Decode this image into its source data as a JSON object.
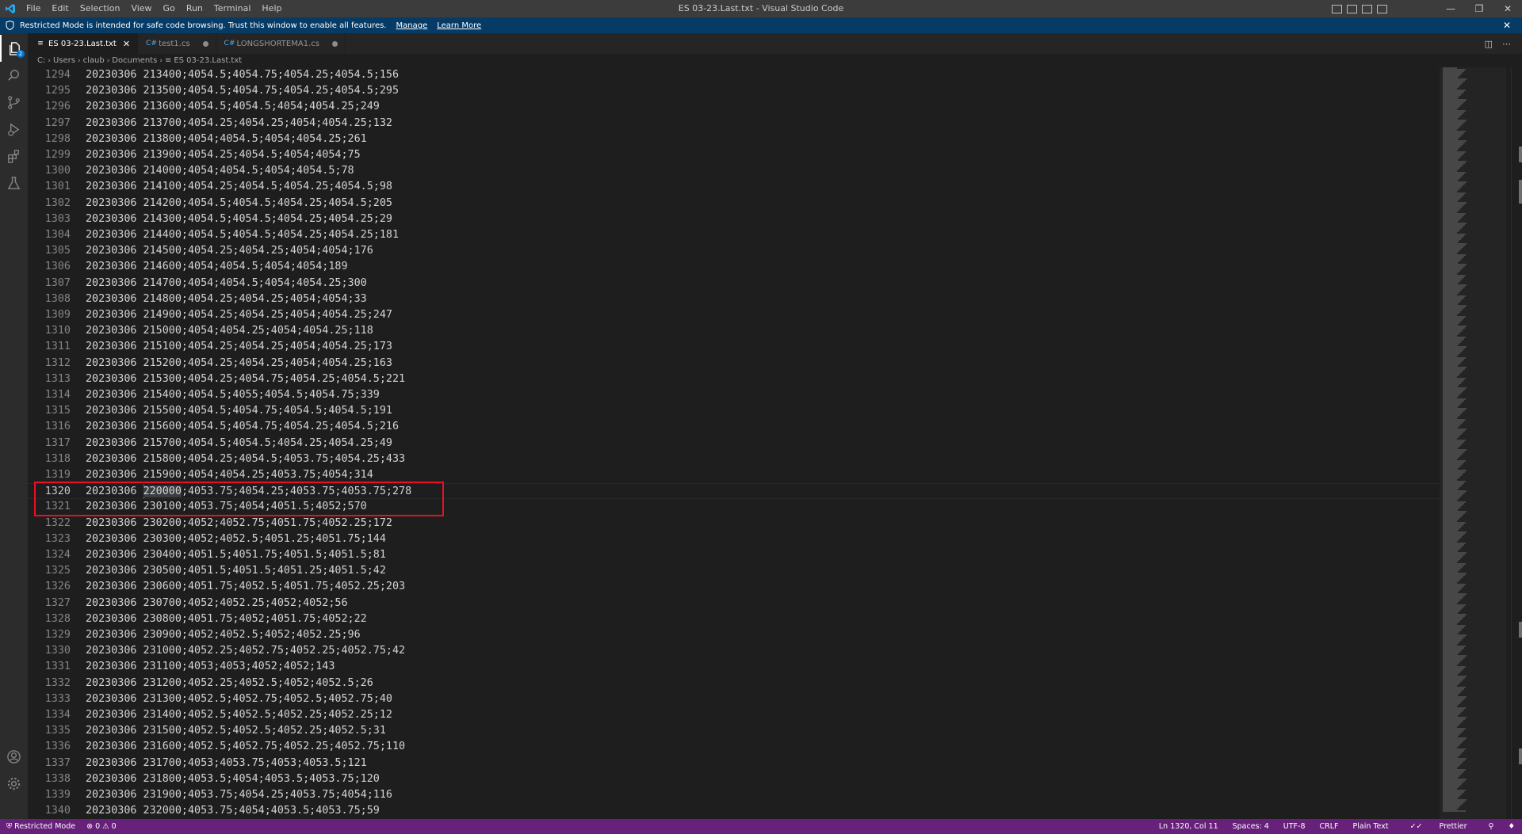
{
  "window": {
    "title": "ES 03-23.Last.txt - Visual Studio Code",
    "menu": [
      "File",
      "Edit",
      "Selection",
      "View",
      "Go",
      "Run",
      "Terminal",
      "Help"
    ]
  },
  "banner": {
    "text": "Restricted Mode is intended for safe code browsing. Trust this window to enable all features.",
    "manage": "Manage",
    "learn_more": "Learn More"
  },
  "activity": {
    "explorer_badge": "2"
  },
  "tabs": [
    {
      "label": "ES 03-23.Last.txt",
      "icon": "text-file-icon",
      "active": true
    },
    {
      "label": "test1.cs",
      "icon": "csharp-file-icon",
      "active": false
    },
    {
      "label": "LONGSHORTEMA1.cs",
      "icon": "csharp-file-icon",
      "active": false
    }
  ],
  "breadcrumb": [
    "C:",
    "Users",
    "claub",
    "Documents",
    "ES 03-23.Last.txt"
  ],
  "editor": {
    "lines": [
      {
        "n": "1294",
        "text": "20230306 213400;4054.5;4054.75;4054.25;4054.5;156"
      },
      {
        "n": "1295",
        "text": "20230306 213500;4054.5;4054.75;4054.25;4054.5;295"
      },
      {
        "n": "1296",
        "text": "20230306 213600;4054.5;4054.5;4054;4054.25;249"
      },
      {
        "n": "1297",
        "text": "20230306 213700;4054.25;4054.25;4054;4054.25;132"
      },
      {
        "n": "1298",
        "text": "20230306 213800;4054;4054.5;4054;4054.25;261"
      },
      {
        "n": "1299",
        "text": "20230306 213900;4054.25;4054.5;4054;4054;75"
      },
      {
        "n": "1300",
        "text": "20230306 214000;4054;4054.5;4054;4054.5;78"
      },
      {
        "n": "1301",
        "text": "20230306 214100;4054.25;4054.5;4054.25;4054.5;98"
      },
      {
        "n": "1302",
        "text": "20230306 214200;4054.5;4054.5;4054.25;4054.5;205"
      },
      {
        "n": "1303",
        "text": "20230306 214300;4054.5;4054.5;4054.25;4054.25;29"
      },
      {
        "n": "1304",
        "text": "20230306 214400;4054.5;4054.5;4054.25;4054.25;181"
      },
      {
        "n": "1305",
        "text": "20230306 214500;4054.25;4054.25;4054;4054;176"
      },
      {
        "n": "1306",
        "text": "20230306 214600;4054;4054.5;4054;4054;189"
      },
      {
        "n": "1307",
        "text": "20230306 214700;4054;4054.5;4054;4054.25;300"
      },
      {
        "n": "1308",
        "text": "20230306 214800;4054.25;4054.25;4054;4054;33"
      },
      {
        "n": "1309",
        "text": "20230306 214900;4054.25;4054.25;4054;4054.25;247"
      },
      {
        "n": "1310",
        "text": "20230306 215000;4054;4054.25;4054;4054.25;118"
      },
      {
        "n": "1311",
        "text": "20230306 215100;4054.25;4054.25;4054;4054.25;173"
      },
      {
        "n": "1312",
        "text": "20230306 215200;4054.25;4054.25;4054;4054.25;163"
      },
      {
        "n": "1313",
        "text": "20230306 215300;4054.25;4054.75;4054.25;4054.5;221"
      },
      {
        "n": "1314",
        "text": "20230306 215400;4054.5;4055;4054.5;4054.75;339"
      },
      {
        "n": "1315",
        "text": "20230306 215500;4054.5;4054.75;4054.5;4054.5;191"
      },
      {
        "n": "1316",
        "text": "20230306 215600;4054.5;4054.75;4054.25;4054.5;216"
      },
      {
        "n": "1317",
        "text": "20230306 215700;4054.5;4054.5;4054.25;4054.25;49"
      },
      {
        "n": "1318",
        "text": "20230306 215800;4054.25;4054.5;4053.75;4054.25;433"
      },
      {
        "n": "1319",
        "text": "20230306 215900;4054;4054.25;4053.75;4054;314"
      },
      {
        "n": "1320",
        "pre": "20230306 ",
        "sel": "220000",
        "post": ";4053.75;4054.25;4053.75;4053.75;278",
        "current": true
      },
      {
        "n": "1321",
        "text": "20230306 230100;4053.75;4054;4051.5;4052;570"
      },
      {
        "n": "1322",
        "text": "20230306 230200;4052;4052.75;4051.75;4052.25;172"
      },
      {
        "n": "1323",
        "text": "20230306 230300;4052;4052.5;4051.25;4051.75;144"
      },
      {
        "n": "1324",
        "text": "20230306 230400;4051.5;4051.75;4051.5;4051.5;81"
      },
      {
        "n": "1325",
        "text": "20230306 230500;4051.5;4051.5;4051.25;4051.5;42"
      },
      {
        "n": "1326",
        "text": "20230306 230600;4051.75;4052.5;4051.75;4052.25;203"
      },
      {
        "n": "1327",
        "text": "20230306 230700;4052;4052.25;4052;4052;56"
      },
      {
        "n": "1328",
        "text": "20230306 230800;4051.75;4052;4051.75;4052;22"
      },
      {
        "n": "1329",
        "text": "20230306 230900;4052;4052.5;4052;4052.25;96"
      },
      {
        "n": "1330",
        "text": "20230306 231000;4052.25;4052.75;4052.25;4052.75;42"
      },
      {
        "n": "1331",
        "text": "20230306 231100;4053;4053;4052;4052;143"
      },
      {
        "n": "1332",
        "text": "20230306 231200;4052.25;4052.5;4052;4052.5;26"
      },
      {
        "n": "1333",
        "text": "20230306 231300;4052.5;4052.75;4052.5;4052.75;40"
      },
      {
        "n": "1334",
        "text": "20230306 231400;4052.5;4052.5;4052.25;4052.25;12"
      },
      {
        "n": "1335",
        "text": "20230306 231500;4052.5;4052.5;4052.25;4052.5;31"
      },
      {
        "n": "1336",
        "text": "20230306 231600;4052.5;4052.75;4052.25;4052.75;110"
      },
      {
        "n": "1337",
        "text": "20230306 231700;4053;4053.75;4053;4053.5;121"
      },
      {
        "n": "1338",
        "text": "20230306 231800;4053.5;4054;4053.5;4053.75;120"
      },
      {
        "n": "1339",
        "text": "20230306 231900;4053.75;4054.25;4053.75;4054;116"
      },
      {
        "n": "1340",
        "text": "20230306 232000;4053.75;4054;4053.5;4053.75;59"
      }
    ]
  },
  "status": {
    "restricted": "Restricted Mode",
    "errors": "0",
    "warnings": "0",
    "position": "Ln 1320, Col 11",
    "spaces": "Spaces: 4",
    "encoding": "UTF-8",
    "eol": "CRLF",
    "language": "Plain Text",
    "formatter": "Prettier"
  },
  "colors": {
    "statusbar": "#68217a",
    "banner": "#063b66",
    "highlight_box": "#e81123"
  }
}
